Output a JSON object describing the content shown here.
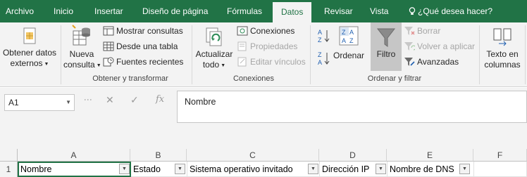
{
  "tabs": [
    "Archivo",
    "Inicio",
    "Insertar",
    "Diseño de página",
    "Fórmulas",
    "Datos",
    "Revisar",
    "Vista"
  ],
  "tell_me": "¿Qué desea hacer?",
  "ribbon": {
    "external": {
      "line1": "Obtener datos",
      "line2": "externos"
    },
    "new_query": {
      "line1": "Nueva",
      "line2": "consulta"
    },
    "show_queries": "Mostrar consultas",
    "from_table": "Desde una tabla",
    "recent_sources": "Fuentes recientes",
    "group_get": "Obtener y transformar",
    "refresh": {
      "line1": "Actualizar",
      "line2": "todo"
    },
    "connections": "Conexiones",
    "properties": "Propiedades",
    "edit_links": "Editar vínculos",
    "group_connections": "Conexiones",
    "sort": "Ordenar",
    "filter": "Filtro",
    "clear": "Borrar",
    "reapply": "Volver a aplicar",
    "advanced": "Avanzadas",
    "group_sort": "Ordenar y filtrar",
    "text_to_columns": {
      "line1": "Texto en",
      "line2": "columnas"
    }
  },
  "formula_bar": {
    "name_box": "A1",
    "content": "Nombre",
    "fx": "fx"
  },
  "grid": {
    "columns": [
      "A",
      "B",
      "C",
      "D",
      "E",
      "F"
    ],
    "row_number": "1",
    "row1": [
      "Nombre",
      "Estado",
      "Sistema operativo invitado",
      "Dirección IP",
      "Nombre de DNS"
    ]
  },
  "colors": {
    "accent": "#217346",
    "ribbon_bg": "#f3f3f3",
    "filter_active": "#c6c6c6"
  }
}
